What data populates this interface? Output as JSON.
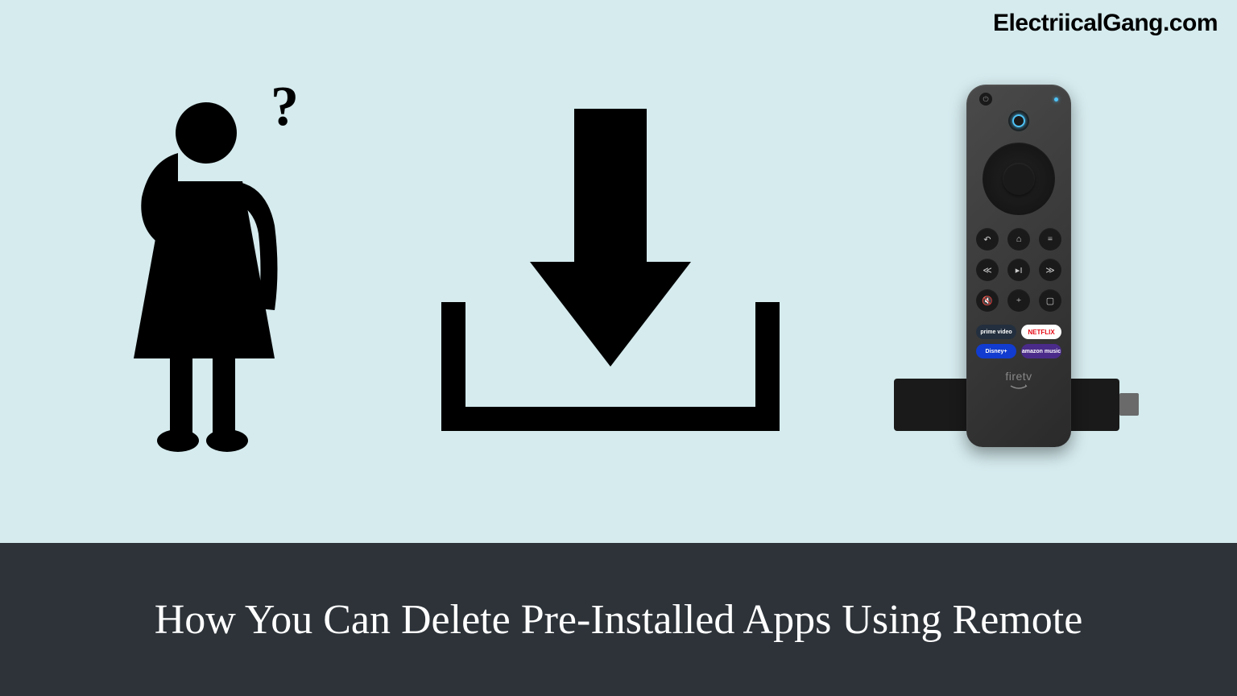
{
  "watermark": "ElectriicalGang.com",
  "title": "How You Can Delete Pre-Installed Apps Using Remote",
  "icons": {
    "thinking_person": "thinking-person-icon",
    "download": "download-icon",
    "remote": "firetv-remote-icon"
  },
  "remote": {
    "brand_label": "firetv",
    "app_buttons": [
      "prime video",
      "NETFLIX",
      "Disney+",
      "amazon music"
    ],
    "round_buttons_row1": [
      "back",
      "home",
      "menu"
    ],
    "round_buttons_row2": [
      "rewind",
      "play-pause",
      "forward"
    ],
    "round_buttons_row3": [
      "mute",
      "plus",
      "tv"
    ]
  },
  "colors": {
    "background": "#d5ebee",
    "title_bar": "#2d3339",
    "title_text": "#ffffff",
    "netflix_red": "#e50914",
    "alexa_blue": "#4fc3f7"
  }
}
